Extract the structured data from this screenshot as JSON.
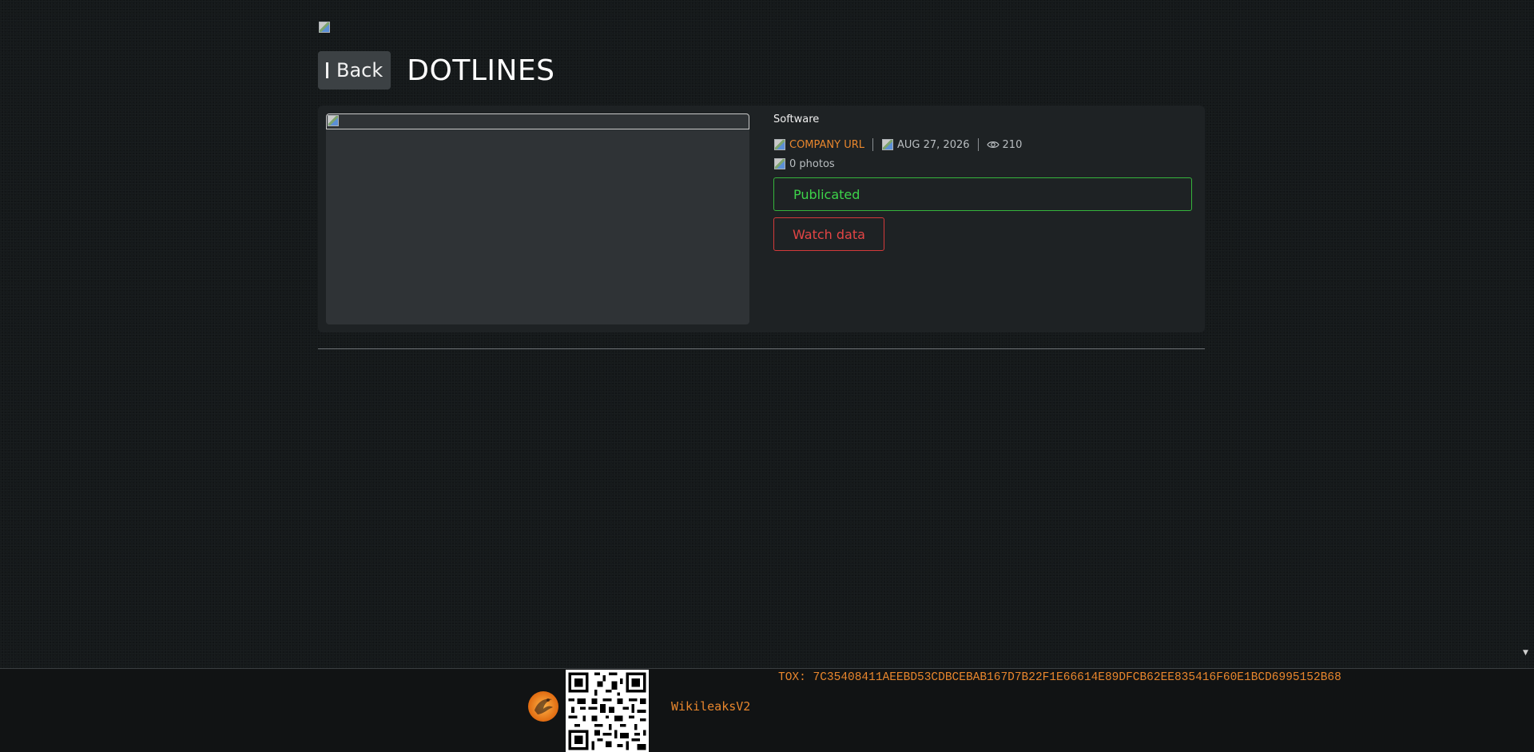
{
  "header": {
    "back_label": "Back",
    "title": "DOTLINES"
  },
  "post": {
    "category": "Software",
    "company_url_label": "COMPANY URL",
    "date": "AUG 27, 2026",
    "views": "210",
    "photos": "0 photos",
    "status": "Publicated",
    "watch_label": "Watch data"
  },
  "footer": {
    "brand": "WikileaksV2",
    "tox": "TOX: 7C35408411AEEBD53CDBCEBAB167D7B22F1E66614E89DFCB62EE835416F60E1BCD6995152B68"
  },
  "colors": {
    "accent_orange": "#e8862d",
    "status_green": "#3dd44a",
    "danger_red": "#e44545",
    "background": "#15191b",
    "card": "#1e2224"
  },
  "icons": {
    "back": "bar-icon",
    "views": "eye-icon",
    "logo": "phoenix-icon"
  }
}
